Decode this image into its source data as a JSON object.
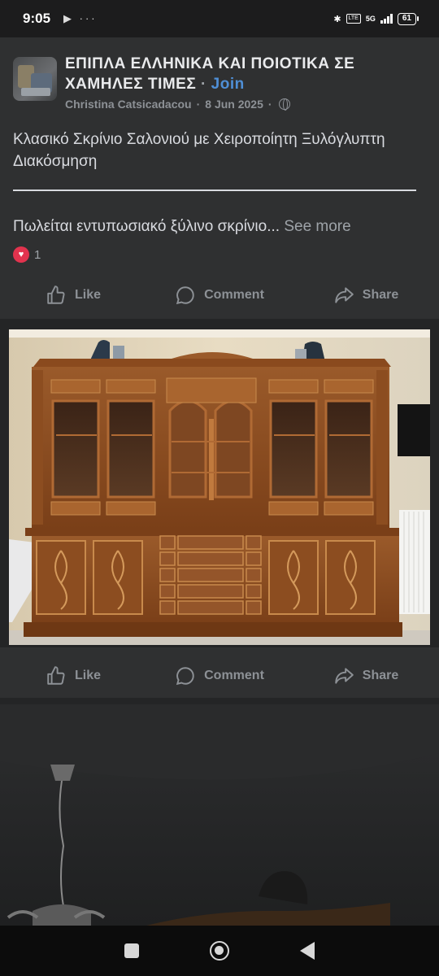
{
  "status_bar": {
    "time": "9:05",
    "left_icons": "▶ ···",
    "network_label": "5G",
    "volte_label": "LTE",
    "battery": "61"
  },
  "post": {
    "group_name": "ΕΠΙΠΛΑ ΕΛΛΗΝΙΚΑ ΚΑΙ ΠΟΙΟΤΙΚΑ ΣΕ ΧΑΜΗΛΕΣ ΤΙΜΕΣ",
    "separator": "·",
    "join_label": "Join",
    "author": "Christina Catsicadacou",
    "date": "8 Jun 2025",
    "title": "Κλασικό Σκρίνιο Σαλονιού με Χειροποίητη Ξυλόγλυπτη Διακόσμηση",
    "body_preview": "Πωλείται εντυπωσιακό ξύλινο σκρίνιο...",
    "see_more_label": "See more",
    "reaction_count": "1",
    "reaction_icon": "heart-icon"
  },
  "actions": {
    "like": "Like",
    "comment": "Comment",
    "share": "Share"
  },
  "colors": {
    "background": "#242526",
    "card": "#2f3031",
    "link": "#4f8fd6",
    "muted": "#8d9196",
    "love": "#e2334e"
  }
}
